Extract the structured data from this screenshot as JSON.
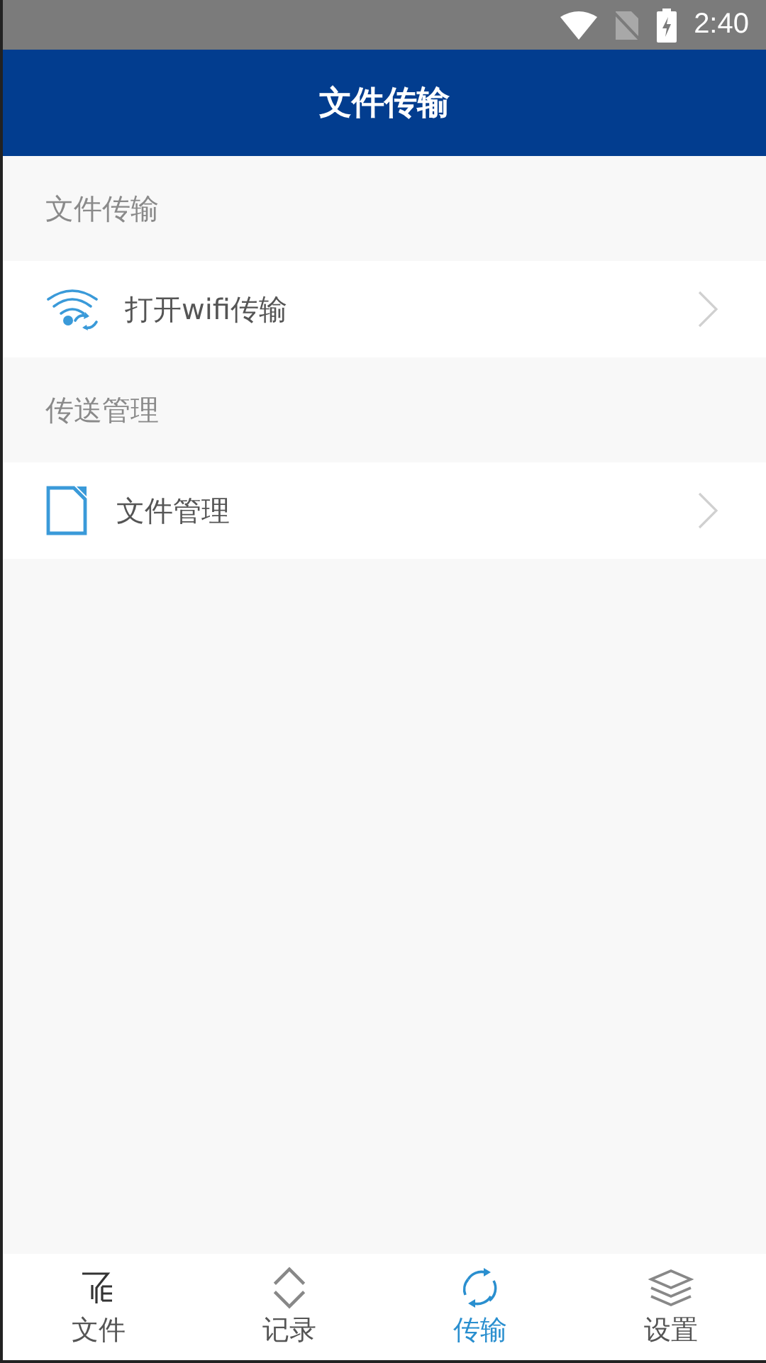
{
  "status_bar": {
    "time": "2:40"
  },
  "header": {
    "title": "文件传输"
  },
  "sections": [
    {
      "title": "文件传输",
      "items": [
        {
          "label": "打开wifi传输",
          "kind": "wifi"
        }
      ]
    },
    {
      "title": "传送管理",
      "items": [
        {
          "label": "文件管理",
          "kind": "file"
        }
      ]
    }
  ],
  "tabs": [
    {
      "label": "文件",
      "kind": "filter",
      "selected": false
    },
    {
      "label": "记录",
      "kind": "updown",
      "selected": false
    },
    {
      "label": "传输",
      "kind": "sync",
      "selected": true
    },
    {
      "label": "设置",
      "kind": "layers",
      "selected": false
    }
  ]
}
